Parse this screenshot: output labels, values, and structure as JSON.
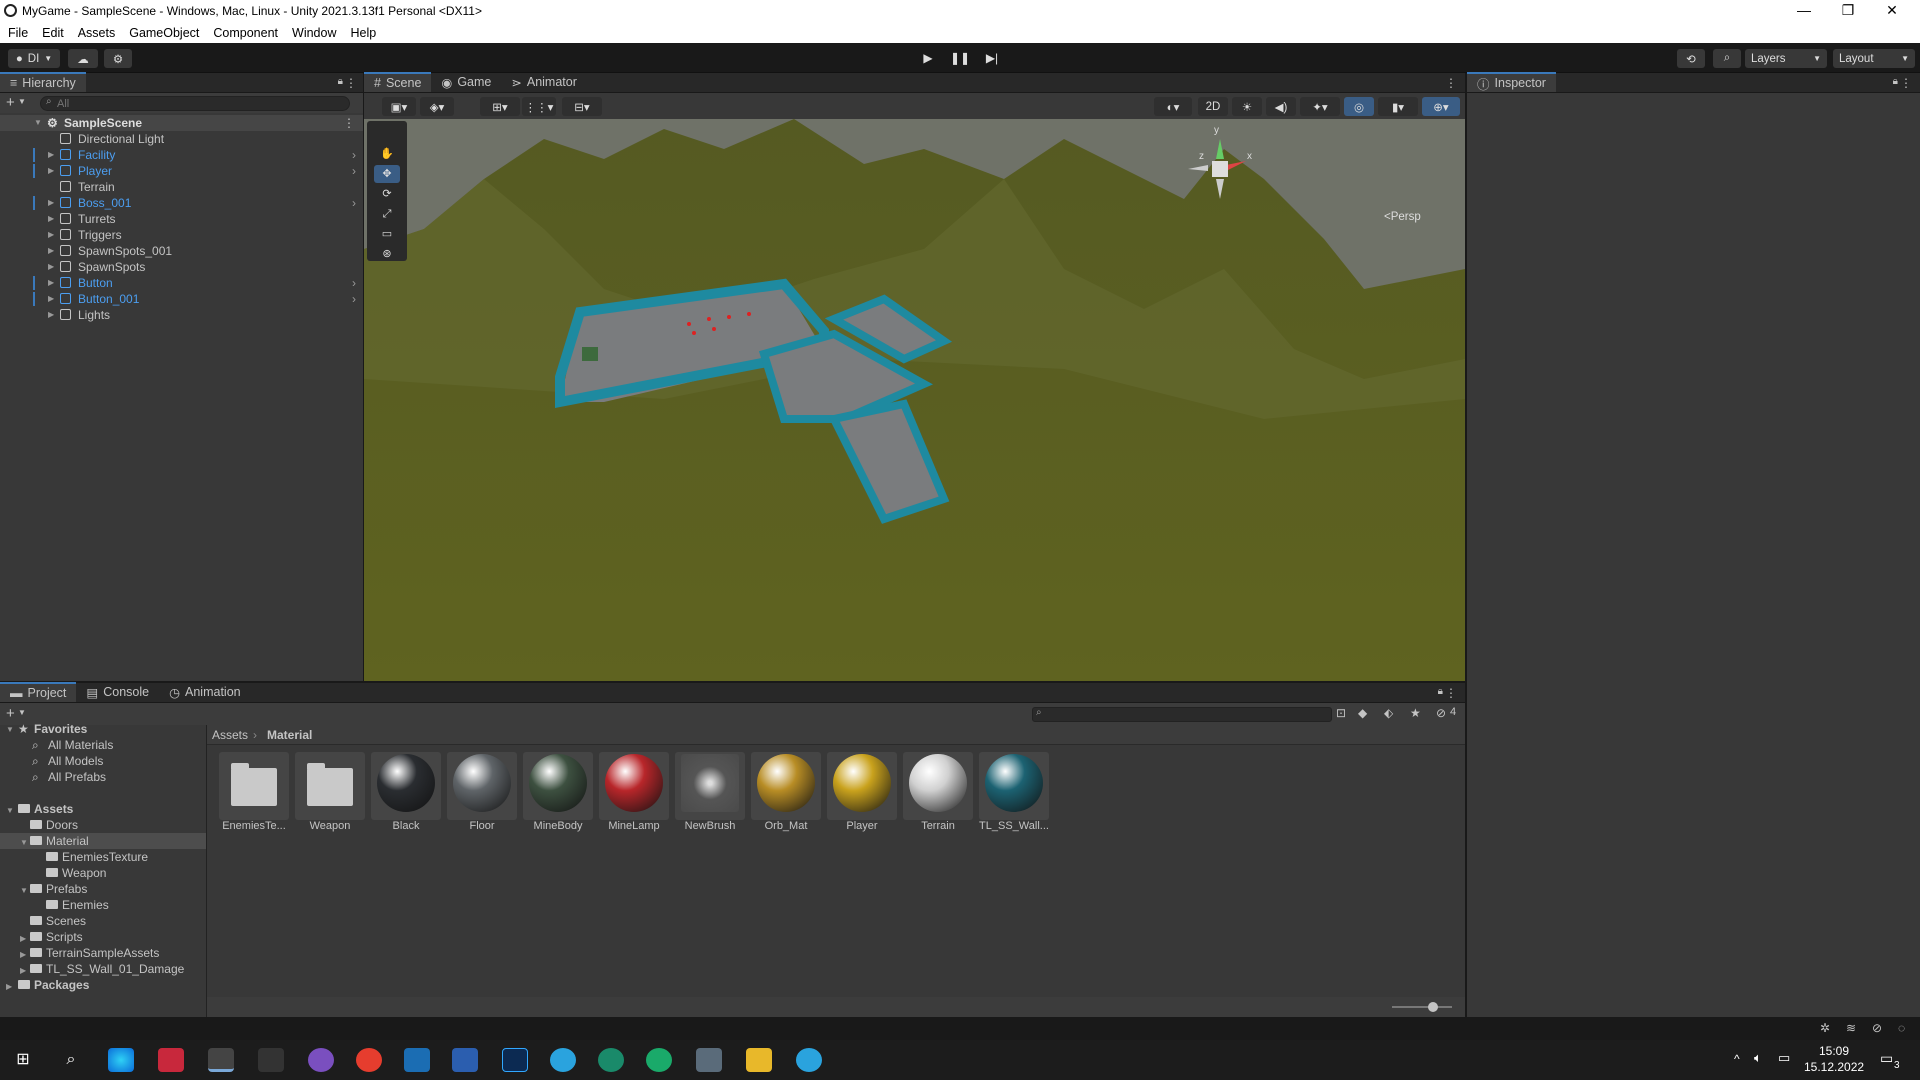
{
  "window": {
    "title": "MyGame - SampleScene - Windows, Mac, Linux - Unity 2021.3.13f1 Personal <DX11>"
  },
  "menu": [
    "File",
    "Edit",
    "Assets",
    "GameObject",
    "Component",
    "Window",
    "Help"
  ],
  "toolbar": {
    "account": "DI",
    "layers": "Layers",
    "layout": "Layout"
  },
  "hierarchy": {
    "tab": "Hierarchy",
    "search_placeholder": "All",
    "scene": "SampleScene",
    "items": [
      {
        "label": "Directional Light",
        "prefab": false,
        "expandable": false
      },
      {
        "label": "Facility",
        "prefab": true,
        "expandable": true
      },
      {
        "label": "Player",
        "prefab": true,
        "expandable": true
      },
      {
        "label": "Terrain",
        "prefab": false,
        "expandable": false
      },
      {
        "label": "Boss_001",
        "prefab": true,
        "expandable": true
      },
      {
        "label": "Turrets",
        "prefab": false,
        "expandable": true
      },
      {
        "label": "Triggers",
        "prefab": false,
        "expandable": true
      },
      {
        "label": "SpawnSpots_001",
        "prefab": false,
        "expandable": true
      },
      {
        "label": "SpawnSpots",
        "prefab": false,
        "expandable": true
      },
      {
        "label": "Button",
        "prefab": true,
        "expandable": true
      },
      {
        "label": "Button_001",
        "prefab": true,
        "expandable": true
      },
      {
        "label": "Lights",
        "prefab": false,
        "expandable": true
      }
    ]
  },
  "scene_view": {
    "tabs": [
      "Scene",
      "Game",
      "Animator"
    ],
    "mode_2d": "2D",
    "persp": "<Persp",
    "gizmo_axes": [
      "y",
      "x",
      "z"
    ]
  },
  "inspector": {
    "tab": "Inspector"
  },
  "project": {
    "tabs": [
      "Project",
      "Console",
      "Animation"
    ],
    "badge_count": "4",
    "breadcrumb": [
      "Assets",
      "Material"
    ],
    "favorites": {
      "label": "Favorites",
      "items": [
        "All Materials",
        "All Models",
        "All Prefabs"
      ]
    },
    "assets_root": "Assets",
    "tree": [
      "Doors",
      "Material",
      "EnemiesTexture",
      "Weapon",
      "Prefabs",
      "Enemies",
      "Scenes",
      "Scripts",
      "TerrainSampleAssets",
      "TL_SS_Wall_01_Damage"
    ],
    "packages": "Packages",
    "assets": [
      {
        "name": "EnemiesTe...",
        "kind": "folder"
      },
      {
        "name": "Weapon",
        "kind": "folder"
      },
      {
        "name": "Black",
        "kind": "material",
        "color": "#2a2d31"
      },
      {
        "name": "Floor",
        "kind": "material",
        "color": "#5f6468"
      },
      {
        "name": "MineBody",
        "kind": "material",
        "color": "#3d5040"
      },
      {
        "name": "MineLamp",
        "kind": "material",
        "color": "#b8262a"
      },
      {
        "name": "NewBrush",
        "kind": "texture",
        "color": "#6a6a6a"
      },
      {
        "name": "Orb_Mat",
        "kind": "material",
        "color": "#b88d25"
      },
      {
        "name": "Player",
        "kind": "material",
        "color": "#c9a21d"
      },
      {
        "name": "Terrain",
        "kind": "material",
        "color": "#d0d0d0"
      },
      {
        "name": "TL_SS_Wall...",
        "kind": "material",
        "color": "#1c6272"
      }
    ]
  },
  "taskbar": {
    "time": "15:09",
    "date": "15.12.2022",
    "notifications": "3"
  }
}
